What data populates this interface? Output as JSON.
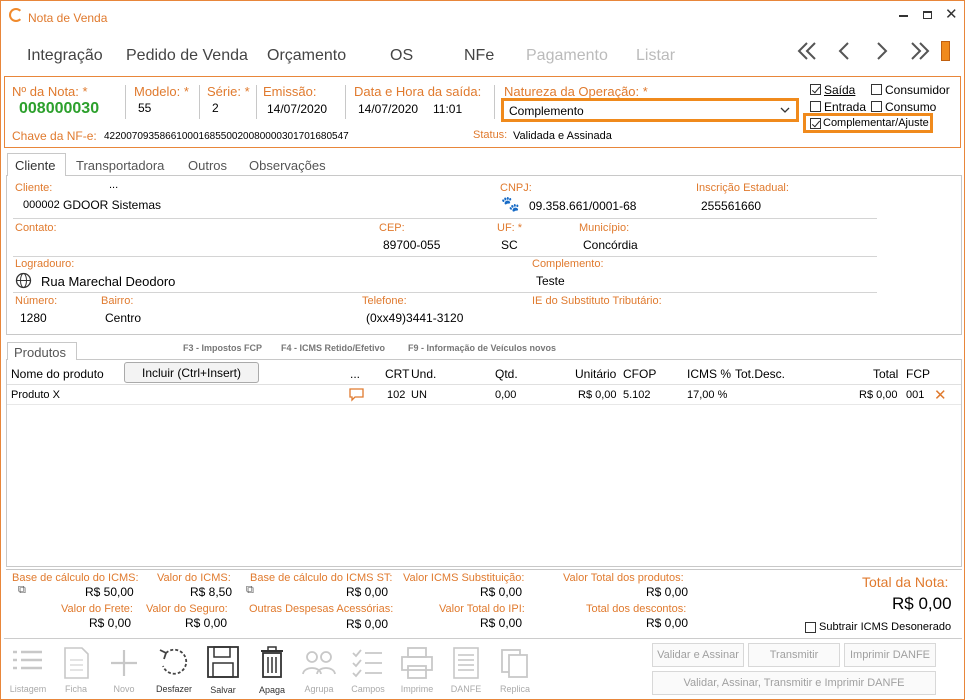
{
  "window": {
    "title": "Nota de Venda"
  },
  "menu": {
    "items": [
      "Integração",
      "Pedido de Venda",
      "Orçamento",
      "OS",
      "NFe"
    ],
    "disabled_items": [
      "Pagamento",
      "Listar"
    ]
  },
  "header": {
    "num_nota_label": "Nº da Nota: *",
    "num_nota": "008000030",
    "modelo_label": "Modelo: *",
    "modelo": "55",
    "serie_label": "Série: *",
    "serie": "2",
    "emissao_label": "Emissão:",
    "emissao": "14/07/2020",
    "saida_label": "Data e Hora da saída:",
    "saida_data": "14/07/2020",
    "saida_hora": "11:01",
    "natureza_label": "Natureza da Operação: *",
    "natureza": "Complemento",
    "chave_label": "Chave da NF-e:",
    "chave": "42200709358661000168550020080000301701680547",
    "status_label": "Status:",
    "status": "Validada e Assinada",
    "checks": {
      "saida": "Saída",
      "entrada": "Entrada",
      "consumidor": "Consumidor",
      "consumo": "Consumo",
      "complementar": "Complementar/Ajuste"
    }
  },
  "tabs": [
    "Cliente",
    "Transportadora",
    "Outros",
    "Observações"
  ],
  "cliente": {
    "cliente_label": "Cliente:",
    "cliente_btn": "...",
    "cliente_cod": "000002",
    "cliente_nome": "GDOOR Sistemas",
    "cnpj_label": "CNPJ:",
    "cnpj": "09.358.661/0001-68",
    "ie_label": "Inscrição Estadual:",
    "ie": "255561660",
    "contato_label": "Contato:",
    "cep_label": "CEP:",
    "cep": "89700-055",
    "uf_label": "UF: *",
    "uf": "SC",
    "municipio_label": "Município:",
    "municipio": "Concórdia",
    "logradouro_label": "Logradouro:",
    "logradouro": "Rua Marechal Deodoro",
    "complemento_label": "Complemento:",
    "complemento": "Teste",
    "numero_label": "Número:",
    "numero": "1280",
    "bairro_label": "Bairro:",
    "bairro": "Centro",
    "telefone_label": "Telefone:",
    "telefone": "(0xx49)3441-3120",
    "ie_sub_label": "IE do Substituto Tributário:"
  },
  "produtos": {
    "tab": "Produtos",
    "shortcuts": [
      "F3 - Impostos FCP",
      "F4 - ICMS Retido/Efetivo",
      "F9 - Informação de Veículos novos"
    ],
    "incluir": "Incluir (Ctrl+Insert)",
    "columns": {
      "nome": "Nome do produto",
      "dots": "...",
      "crt": "CRT",
      "und": "Und.",
      "qtd": "Qtd.",
      "unitario": "Unitário",
      "cfop": "CFOP",
      "icms": "ICMS %",
      "totdesc": "Tot.Desc.",
      "total": "Total",
      "fcp": "FCP"
    },
    "rows": [
      {
        "nome": "Produto X",
        "crt": "102",
        "und": "UN",
        "qtd": "0,00",
        "unitario": "R$ 0,00",
        "cfop": "5.102",
        "icms": "17,00 %",
        "total": "R$ 0,00",
        "fcp": "001"
      }
    ]
  },
  "totais": {
    "bc_icms_label": "Base de cálculo do ICMS:",
    "bc_icms": "R$ 50,00",
    "v_icms_label": "Valor do ICMS:",
    "v_icms": "R$ 8,50",
    "bc_st_label": "Base de cálculo do ICMS ST:",
    "bc_st": "R$ 0,00",
    "v_st_label": "Valor ICMS Substituição:",
    "v_st": "R$ 0,00",
    "v_prod_label": "Valor Total dos produtos:",
    "v_prod": "R$ 0,00",
    "v_frete_label": "Valor do Frete:",
    "v_frete": "R$ 0,00",
    "v_seguro_label": "Valor do Seguro:",
    "v_seguro": "R$ 0,00",
    "outras_label": "Outras Despesas Acessórias:",
    "outras": "R$ 0,00",
    "v_ipi_label": "Valor Total do IPI:",
    "v_ipi": "R$ 0,00",
    "v_desc_label": "Total dos descontos:",
    "v_desc": "R$ 0,00",
    "total_label": "Total da Nota:",
    "total": "R$ 0,00",
    "subtrair": "Subtrair ICMS Desonerado"
  },
  "toolbar": {
    "items": [
      "Listagem",
      "Ficha",
      "Novo",
      "Desfazer",
      "Salvar",
      "Apaga",
      "Agrupa",
      "Campos",
      "Imprime",
      "DANFE",
      "Replica"
    ]
  },
  "actions": {
    "validar": "Validar e Assinar",
    "transmitir": "Transmitir",
    "imprimir": "Imprimir DANFE",
    "tudo": "Validar, Assinar, Transmitir e Imprimir DANFE"
  }
}
